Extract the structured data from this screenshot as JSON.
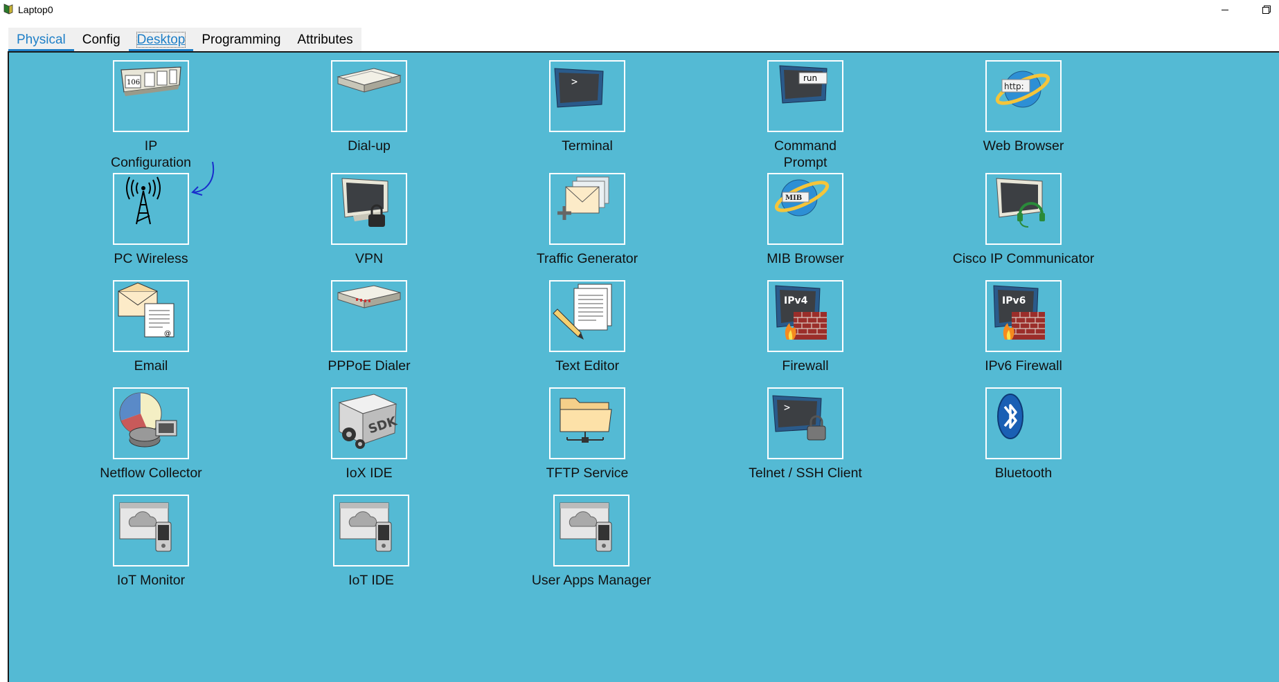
{
  "window": {
    "title": "Laptop0",
    "minimize_label": "",
    "restore_label": "⧉"
  },
  "tabs": [
    {
      "label": "Physical"
    },
    {
      "label": "Config"
    },
    {
      "label": "Desktop"
    },
    {
      "label": "Programming"
    },
    {
      "label": "Attributes"
    }
  ],
  "selected_tab": "Desktop",
  "colors": {
    "desktop_background": "#54bad4",
    "tab_accent": "#1e7fc7",
    "annotation_arrow": "#1a2ecc"
  },
  "apps": [
    {
      "label": "IP\nConfiguration",
      "icon": "ip-config-icon"
    },
    {
      "label": "Dial-up",
      "icon": "modem-icon"
    },
    {
      "label": "Terminal",
      "icon": "terminal-icon"
    },
    {
      "label": "Command\nPrompt",
      "icon": "command-prompt-icon"
    },
    {
      "label": "Web Browser",
      "icon": "web-browser-icon"
    },
    {
      "label": "PC Wireless",
      "icon": "wireless-tower-icon"
    },
    {
      "label": "VPN",
      "icon": "vpn-icon"
    },
    {
      "label": "Traffic Generator",
      "icon": "traffic-generator-icon"
    },
    {
      "label": "MIB Browser",
      "icon": "mib-browser-icon"
    },
    {
      "label": "Cisco IP Communicator",
      "icon": "ip-communicator-icon"
    },
    {
      "label": "Email",
      "icon": "email-icon"
    },
    {
      "label": "PPPoE Dialer",
      "icon": "pppoe-dialer-icon"
    },
    {
      "label": "Text Editor",
      "icon": "text-editor-icon"
    },
    {
      "label": "Firewall",
      "icon": "ipv4-firewall-icon"
    },
    {
      "label": "IPv6 Firewall",
      "icon": "ipv6-firewall-icon"
    },
    {
      "label": "Netflow Collector",
      "icon": "netflow-collector-icon"
    },
    {
      "label": "IoX IDE",
      "icon": "iox-sdk-icon"
    },
    {
      "label": "TFTP Service",
      "icon": "tftp-folder-icon"
    },
    {
      "label": "Telnet / SSH Client",
      "icon": "telnet-ssh-icon"
    },
    {
      "label": "Bluetooth",
      "icon": "bluetooth-icon"
    },
    {
      "label": "IoT Monitor",
      "icon": "iot-monitor-icon"
    },
    {
      "label": "IoT IDE",
      "icon": "iot-ide-icon"
    },
    {
      "label": "User Apps Manager",
      "icon": "user-apps-manager-icon"
    }
  ],
  "icon_text": {
    "ip_config": "106",
    "command_prompt": "run",
    "web_browser": "http:",
    "mib_browser": "MIB",
    "firewall": "IPv4",
    "ipv6_firewall": "IPv6",
    "iox": "SDK",
    "terminal_prompt": ">"
  }
}
